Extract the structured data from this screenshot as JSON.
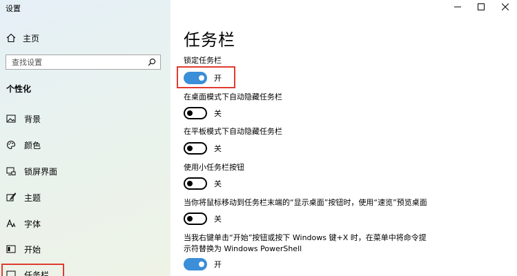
{
  "window": {
    "title": "设置"
  },
  "sidebar": {
    "home_label": "主页",
    "search_placeholder": "查找设置",
    "section_title": "个性化",
    "items": [
      {
        "label": "背景",
        "icon": "picture-icon"
      },
      {
        "label": "颜色",
        "icon": "palette-icon"
      },
      {
        "label": "锁屏界面",
        "icon": "lock-screen-icon"
      },
      {
        "label": "主题",
        "icon": "brush-icon"
      },
      {
        "label": "字体",
        "icon": "font-icon"
      },
      {
        "label": "开始",
        "icon": "start-icon"
      },
      {
        "label": "任务栏",
        "icon": "taskbar-icon"
      }
    ]
  },
  "main": {
    "title": "任务栏",
    "settings": [
      {
        "label": "锁定任务栏",
        "state": "开",
        "on": true
      },
      {
        "label": "在桌面模式下自动隐藏任务栏",
        "state": "关",
        "on": false
      },
      {
        "label": "在平板模式下自动隐藏任务栏",
        "state": "关",
        "on": false
      },
      {
        "label": "使用小任务栏按钮",
        "state": "关",
        "on": false
      },
      {
        "label": "当你将鼠标移动到任务栏末端的“显示桌面”按钮时，使用“速览”预览桌面",
        "state": "关",
        "on": false
      },
      {
        "label_line1": "当我右键单击“开始”按钮或按下 Windows 键+X 时，在菜单中将命令提",
        "label_line2": "示符替换为 Windows PowerShell",
        "state": "开",
        "on": true
      }
    ]
  },
  "colors": {
    "accent": "#3b8ed8",
    "highlight": "#e03a2f"
  }
}
